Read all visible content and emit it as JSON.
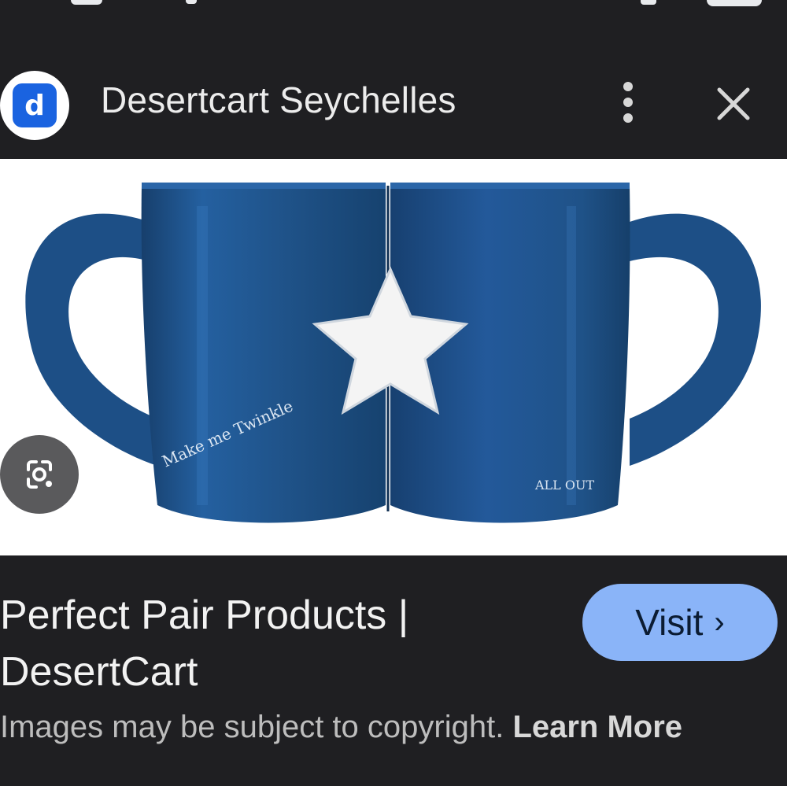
{
  "header": {
    "site_name": "Desertcart Seychelles",
    "site_icon": "desertcart-logo-icon",
    "more_icon": "more-vert-icon",
    "close_icon": "close-icon"
  },
  "image": {
    "engraved_text_left": "Make me Twinkle",
    "engraved_text_right": "ALL OUT",
    "mug_color": "#1f5288",
    "lens_icon": "google-lens-icon"
  },
  "result": {
    "title": "Perfect Pair Products | DesertCart",
    "visit_label": "Visit",
    "visit_chevron": "›",
    "copyright_text": "Images may be subject to copyright.",
    "learn_more": "Learn More"
  },
  "colors": {
    "background": "#1f1f22",
    "visit_button": "#8ab4f8",
    "site_icon_blue": "#1a63e0"
  }
}
